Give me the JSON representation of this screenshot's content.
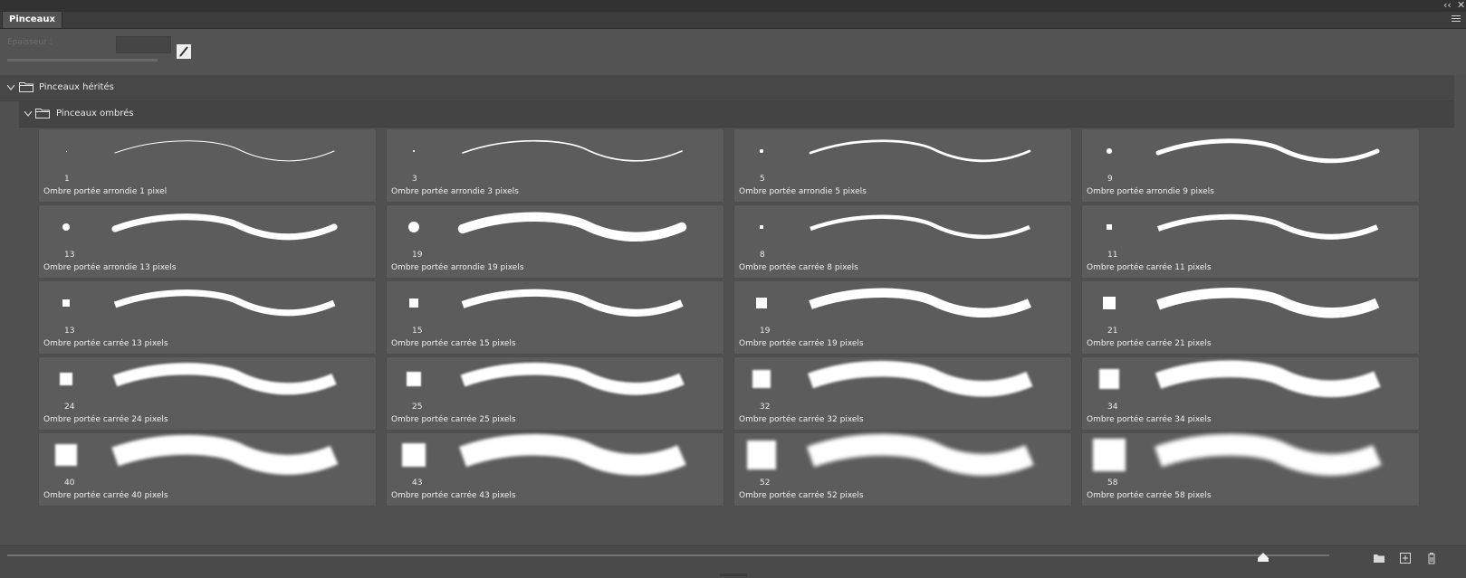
{
  "panel": {
    "tab_label": "Pinceaux",
    "thickness_label": "Épaisseur :",
    "thickness_value": "",
    "thickness_slider_fraction": 0.0
  },
  "groups": [
    {
      "label": "Pinceaux hérités",
      "expanded": true
    },
    {
      "label": "Pinceaux ombrés",
      "expanded": true
    }
  ],
  "brushes": [
    {
      "size": "1",
      "name": "Ombre portée arrondie 1 pixel",
      "shape": "round"
    },
    {
      "size": "3",
      "name": "Ombre portée arrondie 3 pixels",
      "shape": "round"
    },
    {
      "size": "5",
      "name": "Ombre portée arrondie 5 pixels",
      "shape": "round"
    },
    {
      "size": "9",
      "name": "Ombre portée arrondie 9 pixels",
      "shape": "round"
    },
    {
      "size": "13",
      "name": "Ombre portée arrondie 13 pixels",
      "shape": "round"
    },
    {
      "size": "19",
      "name": "Ombre portée arrondie 19 pixels",
      "shape": "round"
    },
    {
      "size": "8",
      "name": "Ombre portée carrée 8 pixels",
      "shape": "square"
    },
    {
      "size": "11",
      "name": "Ombre portée carrée 11 pixels",
      "shape": "square"
    },
    {
      "size": "13",
      "name": "Ombre portée carrée 13 pixels",
      "shape": "square"
    },
    {
      "size": "15",
      "name": "Ombre portée carrée 15 pixels",
      "shape": "square"
    },
    {
      "size": "19",
      "name": "Ombre portée carrée 19 pixels",
      "shape": "square"
    },
    {
      "size": "21",
      "name": "Ombre portée carrée 21 pixels",
      "shape": "square"
    },
    {
      "size": "24",
      "name": "Ombre portée carrée 24 pixels",
      "shape": "square"
    },
    {
      "size": "25",
      "name": "Ombre portée carrée 25 pixels",
      "shape": "square"
    },
    {
      "size": "32",
      "name": "Ombre portée carrée 32 pixels",
      "shape": "square"
    },
    {
      "size": "34",
      "name": "Ombre portée carrée 34 pixels",
      "shape": "square"
    },
    {
      "size": "40",
      "name": "Ombre portée carrée 40 pixels",
      "shape": "square"
    },
    {
      "size": "43",
      "name": "Ombre portée carrée 43 pixels",
      "shape": "square"
    },
    {
      "size": "52",
      "name": "Ombre portée carrée 52 pixels",
      "shape": "square"
    },
    {
      "size": "58",
      "name": "Ombre portée carrée 58 pixels",
      "shape": "square"
    }
  ],
  "preview_zoom_fraction": 0.95,
  "icons": [
    "collapse-panels-icon",
    "close-panel-icon",
    "panel-menu-icon",
    "edit-brush-icon",
    "chevron-down-icon",
    "folder-icon",
    "new-group-icon",
    "new-brush-icon",
    "delete-icon"
  ],
  "colors": {
    "background": "#535353",
    "cell": "#5c5c5c",
    "stroke": "#ffffff",
    "text": "#e8e8e8"
  }
}
